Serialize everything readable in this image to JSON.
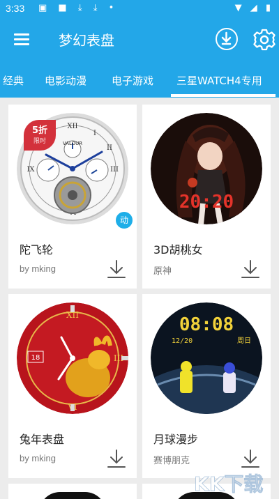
{
  "status_bar": {
    "time": "3:33",
    "left_icons": [
      "image-icon",
      "square-icon",
      "download-icon",
      "download-icon",
      "dot-icon"
    ],
    "right_icons": [
      "wifi-icon",
      "signal-icon",
      "battery-icon"
    ]
  },
  "app_bar": {
    "title": "梦幻表盘",
    "menu_icon": "hamburger-menu-icon",
    "download_icon": "download-circle-icon",
    "settings_icon": "gear-icon"
  },
  "tabs": [
    {
      "label": "经典"
    },
    {
      "label": "电影动漫"
    },
    {
      "label": "电子游戏"
    },
    {
      "label": "三星WATCH4专用"
    }
  ],
  "active_tab": "三星WATCH4专用",
  "cards": [
    {
      "name": "陀飞轮",
      "author": "by mking",
      "badge_sale": "5折",
      "badge_limited": "限时",
      "badge_anim": "动",
      "dial": "Valour tourbillon watch face"
    },
    {
      "name": "3D胡桃女",
      "author": "原神",
      "time_display": "20:20",
      "dial": "anime character watch face"
    },
    {
      "name": "兔年表盘",
      "author": "by mking",
      "date_display": "18",
      "dial": "red lunar rabbit watch face"
    },
    {
      "name": "月球漫步",
      "author": "赛博朋克",
      "time_display": "08:08",
      "date_display": "12/20",
      "weekday_display": "周日",
      "dial": "moon walk cyber watch face"
    }
  ],
  "watermark": "KK下载",
  "colors": {
    "primary": "#23a7e8",
    "badge_red": "#d3313b",
    "badge_blue": "#1eaee8",
    "background": "#ececec"
  }
}
